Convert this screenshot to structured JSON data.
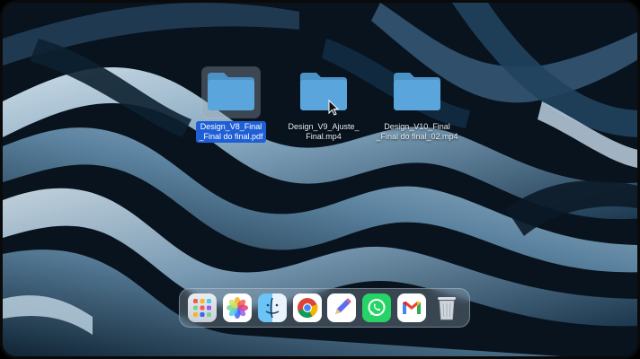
{
  "desktop": {
    "items": [
      {
        "name_line1": "Design_V8_Final",
        "name_line2": "_Final do final.pdf",
        "selected": true
      },
      {
        "name_line1": "Design_V9_Ajuste_",
        "name_line2": "Final.mp4",
        "selected": false
      },
      {
        "name_line1": "Design_V10_Final",
        "name_line2": "_Final do final_02.mp4",
        "selected": false
      }
    ]
  },
  "dock": {
    "apps": [
      {
        "name": "Launchpad",
        "icon": "launchpad-icon"
      },
      {
        "name": "Photos",
        "icon": "photos-icon"
      },
      {
        "name": "Finder",
        "icon": "finder-icon"
      },
      {
        "name": "Google Chrome",
        "icon": "chrome-icon"
      },
      {
        "name": "Freeform",
        "icon": "pencil-icon"
      },
      {
        "name": "WhatsApp",
        "icon": "whatsapp-icon"
      },
      {
        "name": "Gmail",
        "icon": "gmail-icon"
      },
      {
        "name": "Trash",
        "icon": "trash-icon"
      }
    ]
  },
  "colors": {
    "folder": "#5aa6dc",
    "selection": "#1f5fd6",
    "wallpaper_light": "#a9c8dd",
    "wallpaper_dark": "#07121c"
  }
}
